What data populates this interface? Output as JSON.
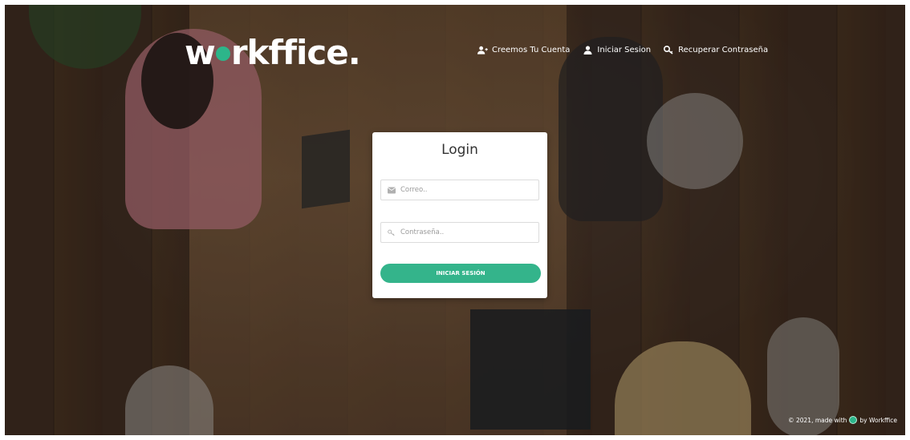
{
  "brand": {
    "logo_prefix": "w",
    "logo_suffix": "rkffice.",
    "accent_color": "#34b48b"
  },
  "nav": {
    "items": [
      {
        "label": "Creemos Tu Cuenta",
        "icon": "user-plus-icon"
      },
      {
        "label": "Iniciar Sesion",
        "icon": "user-icon"
      },
      {
        "label": "Recuperar Contraseña",
        "icon": "key-icon"
      }
    ]
  },
  "login": {
    "title": "Login",
    "email_placeholder": "Correo..",
    "email_icon": "envelope-icon",
    "password_placeholder": "Contraseña..",
    "password_icon": "key-icon",
    "submit_label": "INICIAR SESIÓN"
  },
  "footer": {
    "prefix": "© 2021, made with",
    "suffix": "by Workffice",
    "icon": "heart-icon"
  }
}
